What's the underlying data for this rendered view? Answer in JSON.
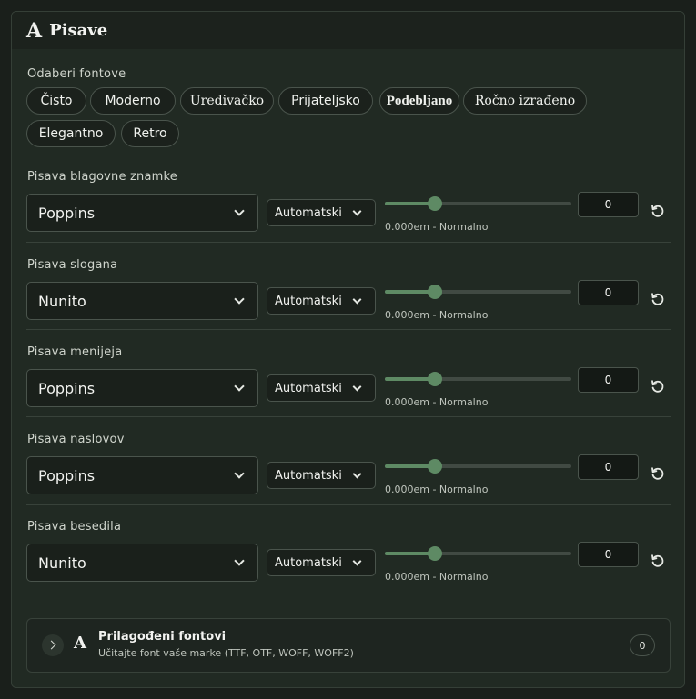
{
  "header": {
    "icon": "A",
    "icon_name": "font-icon",
    "title": "Pisave"
  },
  "presets": {
    "label": "Odaberi fontove",
    "items": [
      "Čisto",
      "Moderno",
      "Uredivačko",
      "Prijateljsko",
      "Podebljano",
      "Ročno izrađeno",
      "Elegantno",
      "Retro"
    ]
  },
  "rows": [
    {
      "label": "Pisava blagovne znamke",
      "font": "Poppins",
      "weight": "Automatski",
      "spacing_value": 0.27,
      "caption": "0.000em - Normalno",
      "number": "0"
    },
    {
      "label": "Pisava slogana",
      "font": "Nunito",
      "weight": "Automatski",
      "spacing_value": 0.27,
      "caption": "0.000em - Normalno",
      "number": "0"
    },
    {
      "label": "Pisava menijeja",
      "font": "Poppins",
      "weight": "Automatski",
      "spacing_value": 0.27,
      "caption": "0.000em - Normalno",
      "number": "0"
    },
    {
      "label": "Pisava naslovov",
      "font": "Poppins",
      "weight": "Automatski",
      "spacing_value": 0.27,
      "caption": "0.000em - Normalno",
      "number": "0"
    },
    {
      "label": "Pisava besedila",
      "font": "Nunito",
      "weight": "Automatski",
      "spacing_value": 0.27,
      "caption": "0.000em - Normalno",
      "number": "0"
    }
  ],
  "custom_fonts": {
    "icon": "A",
    "title": "Prilagođeni fontovi",
    "subtitle": "Učitajte font vaše marke (TTF, OTF, WOFF, WOFF2)",
    "count": "0"
  },
  "colors": {
    "accent": "#5e8a64",
    "background": "#212a23"
  }
}
